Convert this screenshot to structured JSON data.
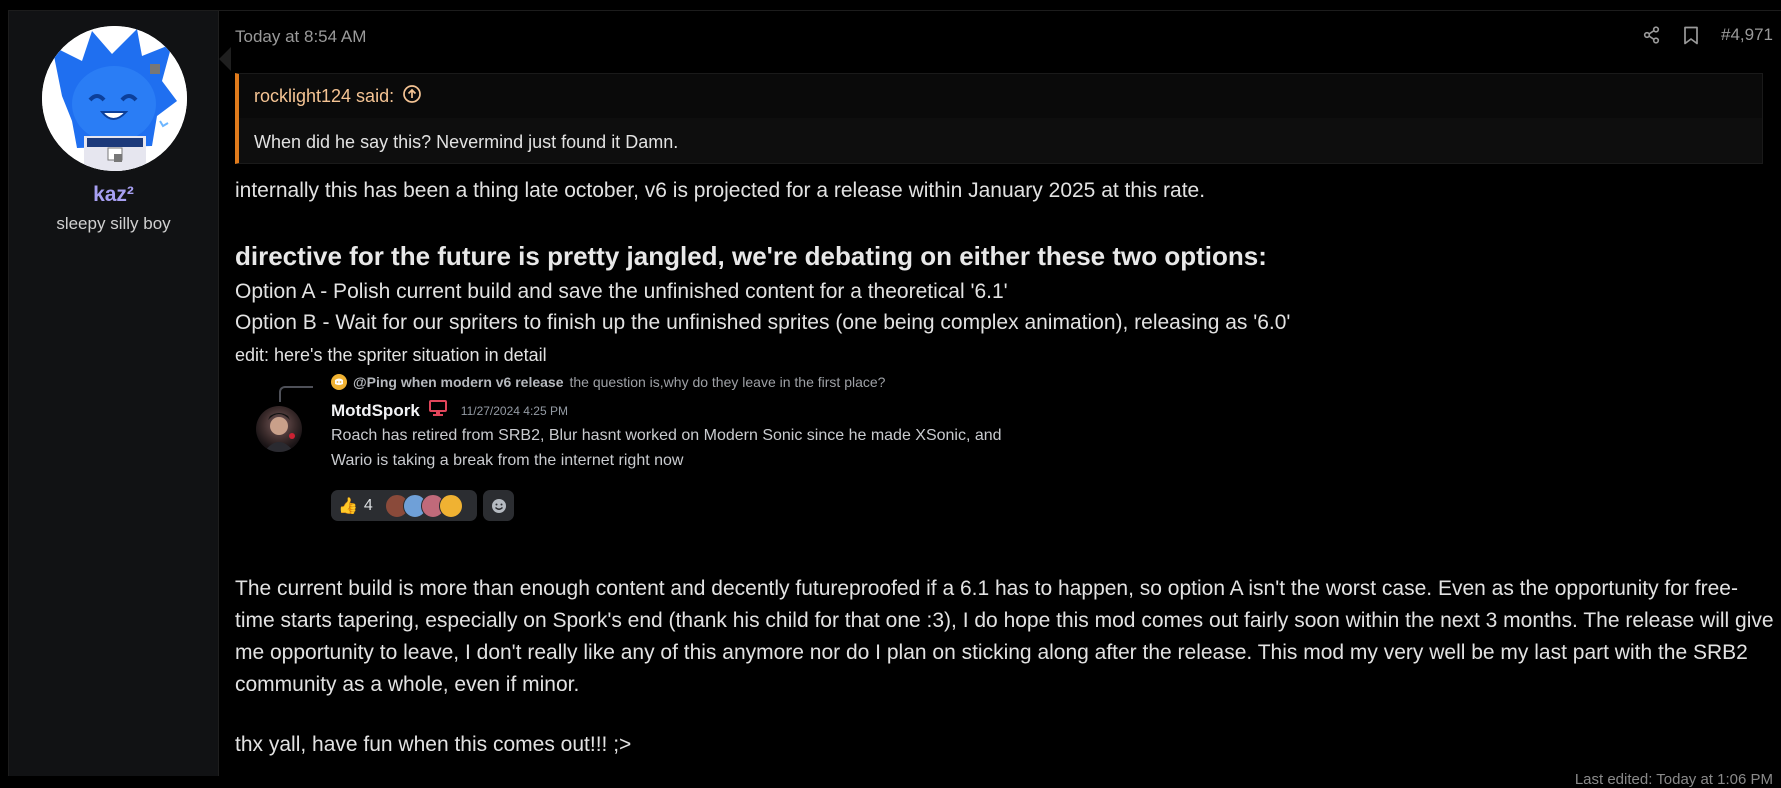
{
  "user": {
    "name": "kaz²",
    "title": "sleepy silly boy"
  },
  "post": {
    "timestamp": "Today at 8:54 AM",
    "post_number": "#4,971",
    "quote": {
      "author_label": "rocklight124 said:",
      "text": "When did he say this? Nevermind just found it Damn."
    },
    "p1": "internally this has been a thing late october, v6 is projected for a release within January 2025 at this rate.",
    "heading": "directive for the future is pretty jangled, we're debating on either these two options:",
    "option_a": "Option A - Polish current build and save the unfinished content for a theoretical '6.1'",
    "option_b": "Option B - Wait for our spriters to finish up the unfinished sprites (one being complex animation), releasing as '6.0'",
    "edit_note": "edit: here's the spriter situation in detail",
    "discord": {
      "reply_name": "@Ping when modern v6 release",
      "reply_text": "the question is,why do they leave in the first place?",
      "author": "MotdSpork",
      "time": "11/27/2024 4:25 PM",
      "line1": "Roach has retired from SRB2, Blur hasnt worked on Modern Sonic since he made XSonic, and",
      "line2": "Wario is taking a break from the internet right now",
      "reaction_emoji": "👍",
      "reaction_count": "4"
    },
    "paragraph": "The current build is more than enough content and decently futureproofed if a 6.1 has to happen, so option A isn't the worst case. Even as the opportunity for free-time starts tapering, especially on Spork's end (thank his child for that one :3), I do hope this mod comes out fairly soon within the next 3 months. The release will give me opportunity to leave, I don't really like any of this anymore nor do I plan on sticking along after the release. This mod my very well be my last part with the SRB2 community as a whole, even if minor.",
    "closing": "thx yall, have fun when this comes out!!! ;>",
    "last_edited": "Last edited: Today at 1:06 PM"
  },
  "colors": {
    "accent_username": "#a79ff2",
    "quote_border": "#e07b1c",
    "avatar_blue": "#1e6ee8"
  }
}
